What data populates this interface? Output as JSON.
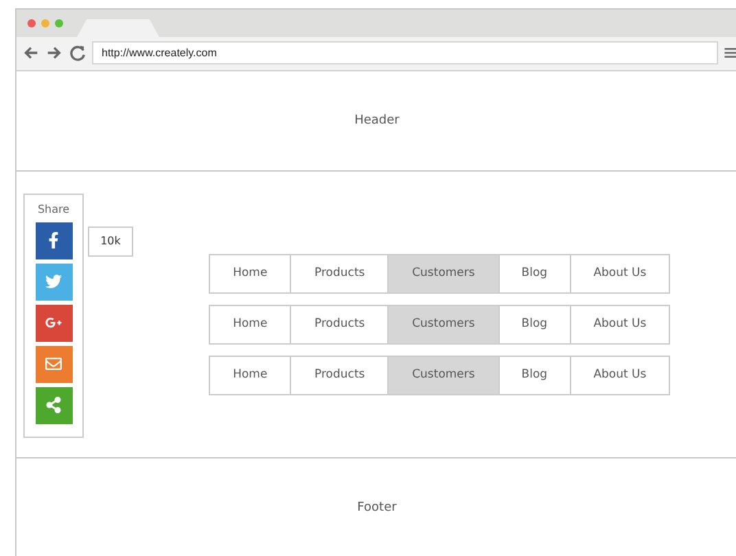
{
  "browser": {
    "url": "http://www.creately.com"
  },
  "header": {
    "label": "Header"
  },
  "share": {
    "title": "Share",
    "count": "10k",
    "buttons": [
      {
        "kind": "facebook",
        "color": "#2a5ea8"
      },
      {
        "kind": "twitter",
        "color": "#4bb0e3"
      },
      {
        "kind": "googleplus",
        "color": "#d9473b"
      },
      {
        "kind": "email",
        "color": "#ec7c30"
      },
      {
        "kind": "share",
        "color": "#4ea82e"
      }
    ]
  },
  "nav_rows": [
    {
      "items": [
        {
          "label": "Home",
          "selected": false
        },
        {
          "label": "Products",
          "selected": false
        },
        {
          "label": "Customers",
          "selected": true
        },
        {
          "label": "Blog",
          "selected": false
        },
        {
          "label": "About Us",
          "selected": false
        }
      ]
    },
    {
      "items": [
        {
          "label": "Home",
          "selected": false
        },
        {
          "label": "Products",
          "selected": false
        },
        {
          "label": "Customers",
          "selected": true
        },
        {
          "label": "Blog",
          "selected": false
        },
        {
          "label": "About Us",
          "selected": false
        }
      ]
    },
    {
      "items": [
        {
          "label": "Home",
          "selected": false
        },
        {
          "label": "Products",
          "selected": false
        },
        {
          "label": "Customers",
          "selected": true
        },
        {
          "label": "Blog",
          "selected": false
        },
        {
          "label": "About Us",
          "selected": false
        }
      ]
    }
  ],
  "footer": {
    "label": "Footer"
  }
}
